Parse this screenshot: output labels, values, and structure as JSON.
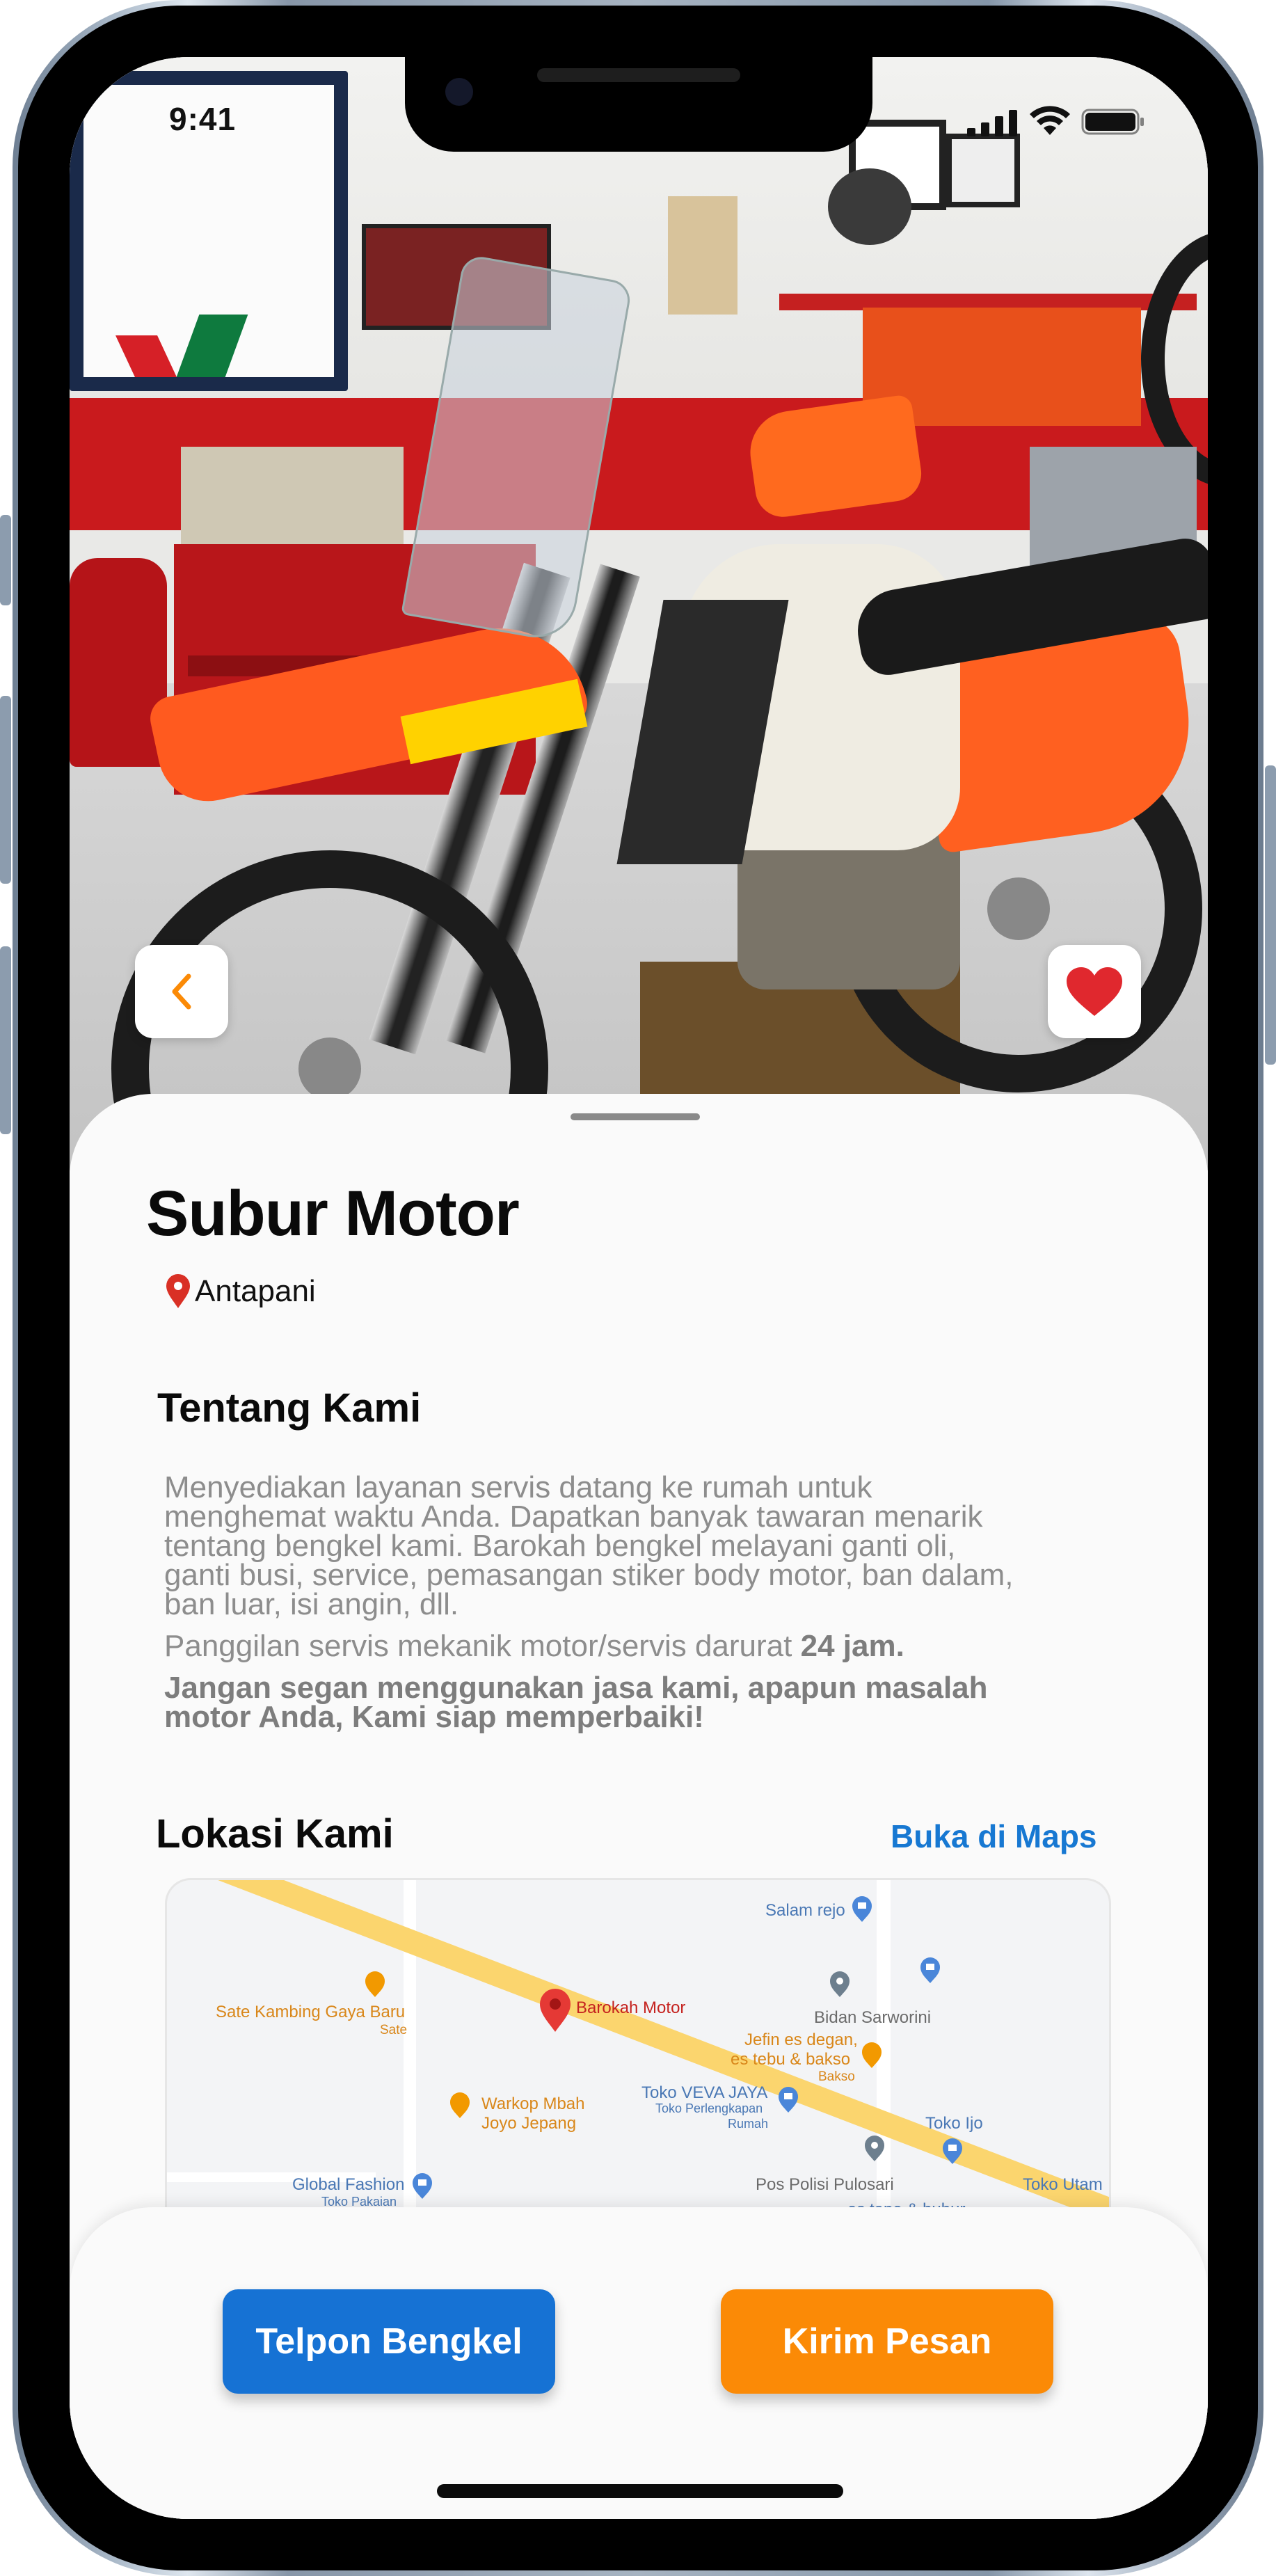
{
  "status_bar": {
    "time": "9:41"
  },
  "shop": {
    "name": "Subur Motor",
    "location": "Antapani"
  },
  "about": {
    "heading": "Tentang Kami",
    "paragraph_1": "Menyediakan layanan servis datang ke rumah untuk menghemat waktu Anda. Dapatkan banyak tawaran menarik tentang bengkel kami. Barokah bengkel melayani ganti oli, ganti busi, service, pemasangan stiker body motor, ban dalam, ban luar, isi angin, dll.",
    "paragraph_2_prefix": "Panggilan servis mekanik motor/servis darurat ",
    "paragraph_2_bold": "24 jam.",
    "paragraph_3": "Jangan segan menggunakan jasa kami, apapun masalah motor Anda, Kami siap memperbaiki!"
  },
  "location_section": {
    "heading": "Lokasi Kami",
    "maps_link": "Buka di Maps",
    "map_labels": {
      "salam_rejo": "Salam rejo",
      "sate_kambing": "Sate Kambing Gaya Baru",
      "sate_sub": "Sate",
      "barokah": "Barokah Motor",
      "bidan": "Bidan Sarworini",
      "jefin": "Jefin es degan,",
      "jefin2": "es tebu & bakso",
      "jefin_sub": "Bakso",
      "warkop": "Warkop Mbah",
      "warkop2": "Joyo Jepang",
      "veva": "Toko VEVA JAYA",
      "veva_sub": "Toko Perlengkapan",
      "veva_sub2": "Rumah",
      "toko_ijo": "Toko Ijo",
      "global": "Global Fashion",
      "global_sub": "Toko Pakaian",
      "polisi": "Pos Polisi Pulosari",
      "toko_utam": "Toko Utam",
      "es_tape": "es tape & bubur"
    }
  },
  "actions": {
    "call_label": "Telpon Bengkel",
    "message_label": "Kirim Pesan"
  },
  "colors": {
    "primary_blue": "#1672d4",
    "accent_orange": "#fb8a06",
    "link_blue": "#1778d2",
    "heart_red": "#e0282e",
    "pin_red": "#d93025"
  },
  "icons": {
    "back": "chevron-left-icon",
    "favorite": "heart-icon",
    "location": "map-pin-icon"
  }
}
